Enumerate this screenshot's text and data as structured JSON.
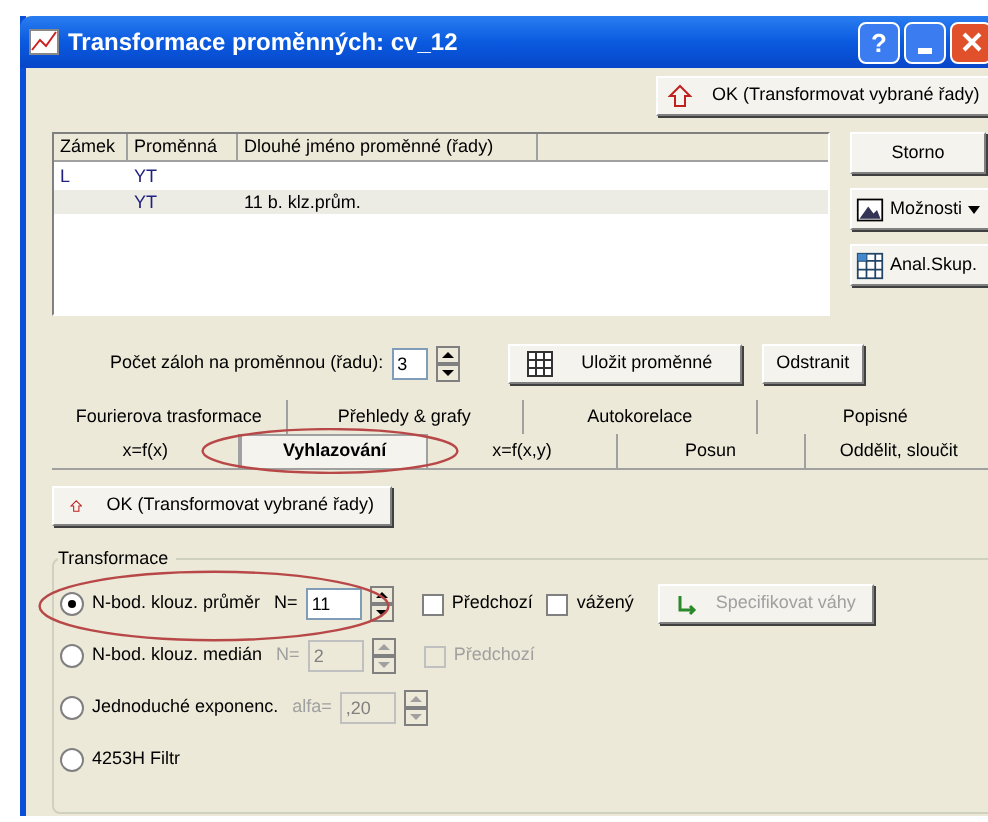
{
  "window": {
    "title": "Transformace proměnných: cv_12",
    "help_button": "?"
  },
  "top_ok_button": "OK (Transformovat vybrané řady)",
  "table": {
    "columns": [
      "Zámek",
      "Proměnná",
      "Dlouhé jméno proměnné (řady)"
    ],
    "rows": [
      {
        "lock": "L",
        "variable": "YT",
        "selected": false
      },
      {
        "variable": "YT",
        "long_name": "11 b. klz.prům.",
        "selected": true
      }
    ]
  },
  "side_buttons": [
    {
      "label": "Storno",
      "kind": "plain"
    },
    {
      "label": "Možnosti",
      "kind": "menu"
    },
    {
      "label": "Anal.Skup.",
      "kind": "grid"
    }
  ],
  "backups": {
    "label": "Počet záloh na proměnnou (řadu):",
    "value": "3"
  },
  "save_button": "Uložit proměnné",
  "remove_button": "Odstranit",
  "tab_rows": [
    [
      {
        "label": "Fourierova trasformace",
        "selected": false
      },
      {
        "label": "Přehledy & grafy",
        "selected": false
      },
      {
        "label": "Autokorelace",
        "selected": false
      },
      {
        "label": "Popisné",
        "selected": false
      }
    ],
    [
      {
        "label": "x=f(x)",
        "selected": false
      },
      {
        "label": "Vyhlazování",
        "selected": true,
        "circled": true
      },
      {
        "label": "x=f(x,y)",
        "selected": false
      },
      {
        "label": "Posun",
        "selected": false
      },
      {
        "label": "Oddělit, sloučit",
        "selected": false
      }
    ]
  ],
  "panel_ok_button": "OK (Transformovat vybrané řady)",
  "group": {
    "title": "Transformace",
    "options": [
      {
        "label": "N-bod. klouz. průměr",
        "selected": true,
        "circled": true,
        "param": {
          "label": "N=",
          "value": "11",
          "disabled": false
        },
        "checkboxes": [
          {
            "label": "Předchozí",
            "checked": false,
            "disabled": false
          },
          {
            "label": "vážený",
            "checked": false,
            "disabled": false
          }
        ],
        "button": {
          "label": "Specifikovat váhy",
          "disabled": true
        }
      },
      {
        "label": "N-bod. klouz. medián",
        "selected": false,
        "param": {
          "label": "N=",
          "value": "2",
          "disabled": true
        },
        "checkboxes": [
          {
            "label": "Předchozí",
            "checked": false,
            "disabled": true
          }
        ]
      },
      {
        "label": "Jednoduché exponenc.",
        "selected": false,
        "param": {
          "label": "alfa=",
          "value": ",20",
          "disabled": true
        }
      },
      {
        "label": "4253H Filtr",
        "selected": false
      }
    ]
  }
}
